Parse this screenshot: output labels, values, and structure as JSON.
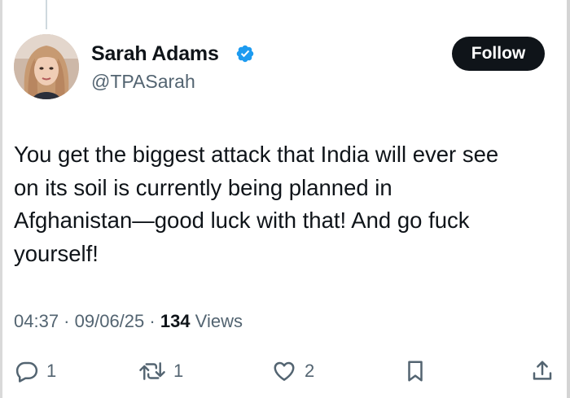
{
  "author": {
    "name": "Sarah Adams",
    "handle": "@TPASarah",
    "verified_icon": "verified-badge-icon",
    "verified_color": "#1d9bf0"
  },
  "follow_button": {
    "label": "Follow"
  },
  "tweet": {
    "lines": [
      "You get the biggest attack that India will ever see",
      "on its soil is currently being planned in",
      "Afghanistan—good luck with that! And go fuck",
      "yourself!"
    ]
  },
  "meta": {
    "time": "04:37",
    "date": "09/06/25",
    "separator": " · ",
    "views_count": "134",
    "views_label": "Views"
  },
  "actions": {
    "reply": {
      "icon": "reply-icon",
      "count": "1"
    },
    "retweet": {
      "icon": "retweet-icon",
      "count": "1"
    },
    "like": {
      "icon": "heart-icon",
      "count": "2"
    },
    "bookmark": {
      "icon": "bookmark-icon"
    },
    "share": {
      "icon": "share-icon"
    }
  },
  "colors": {
    "text_primary": "#0f1419",
    "text_secondary": "#536471",
    "follow_bg": "#0f1419"
  }
}
